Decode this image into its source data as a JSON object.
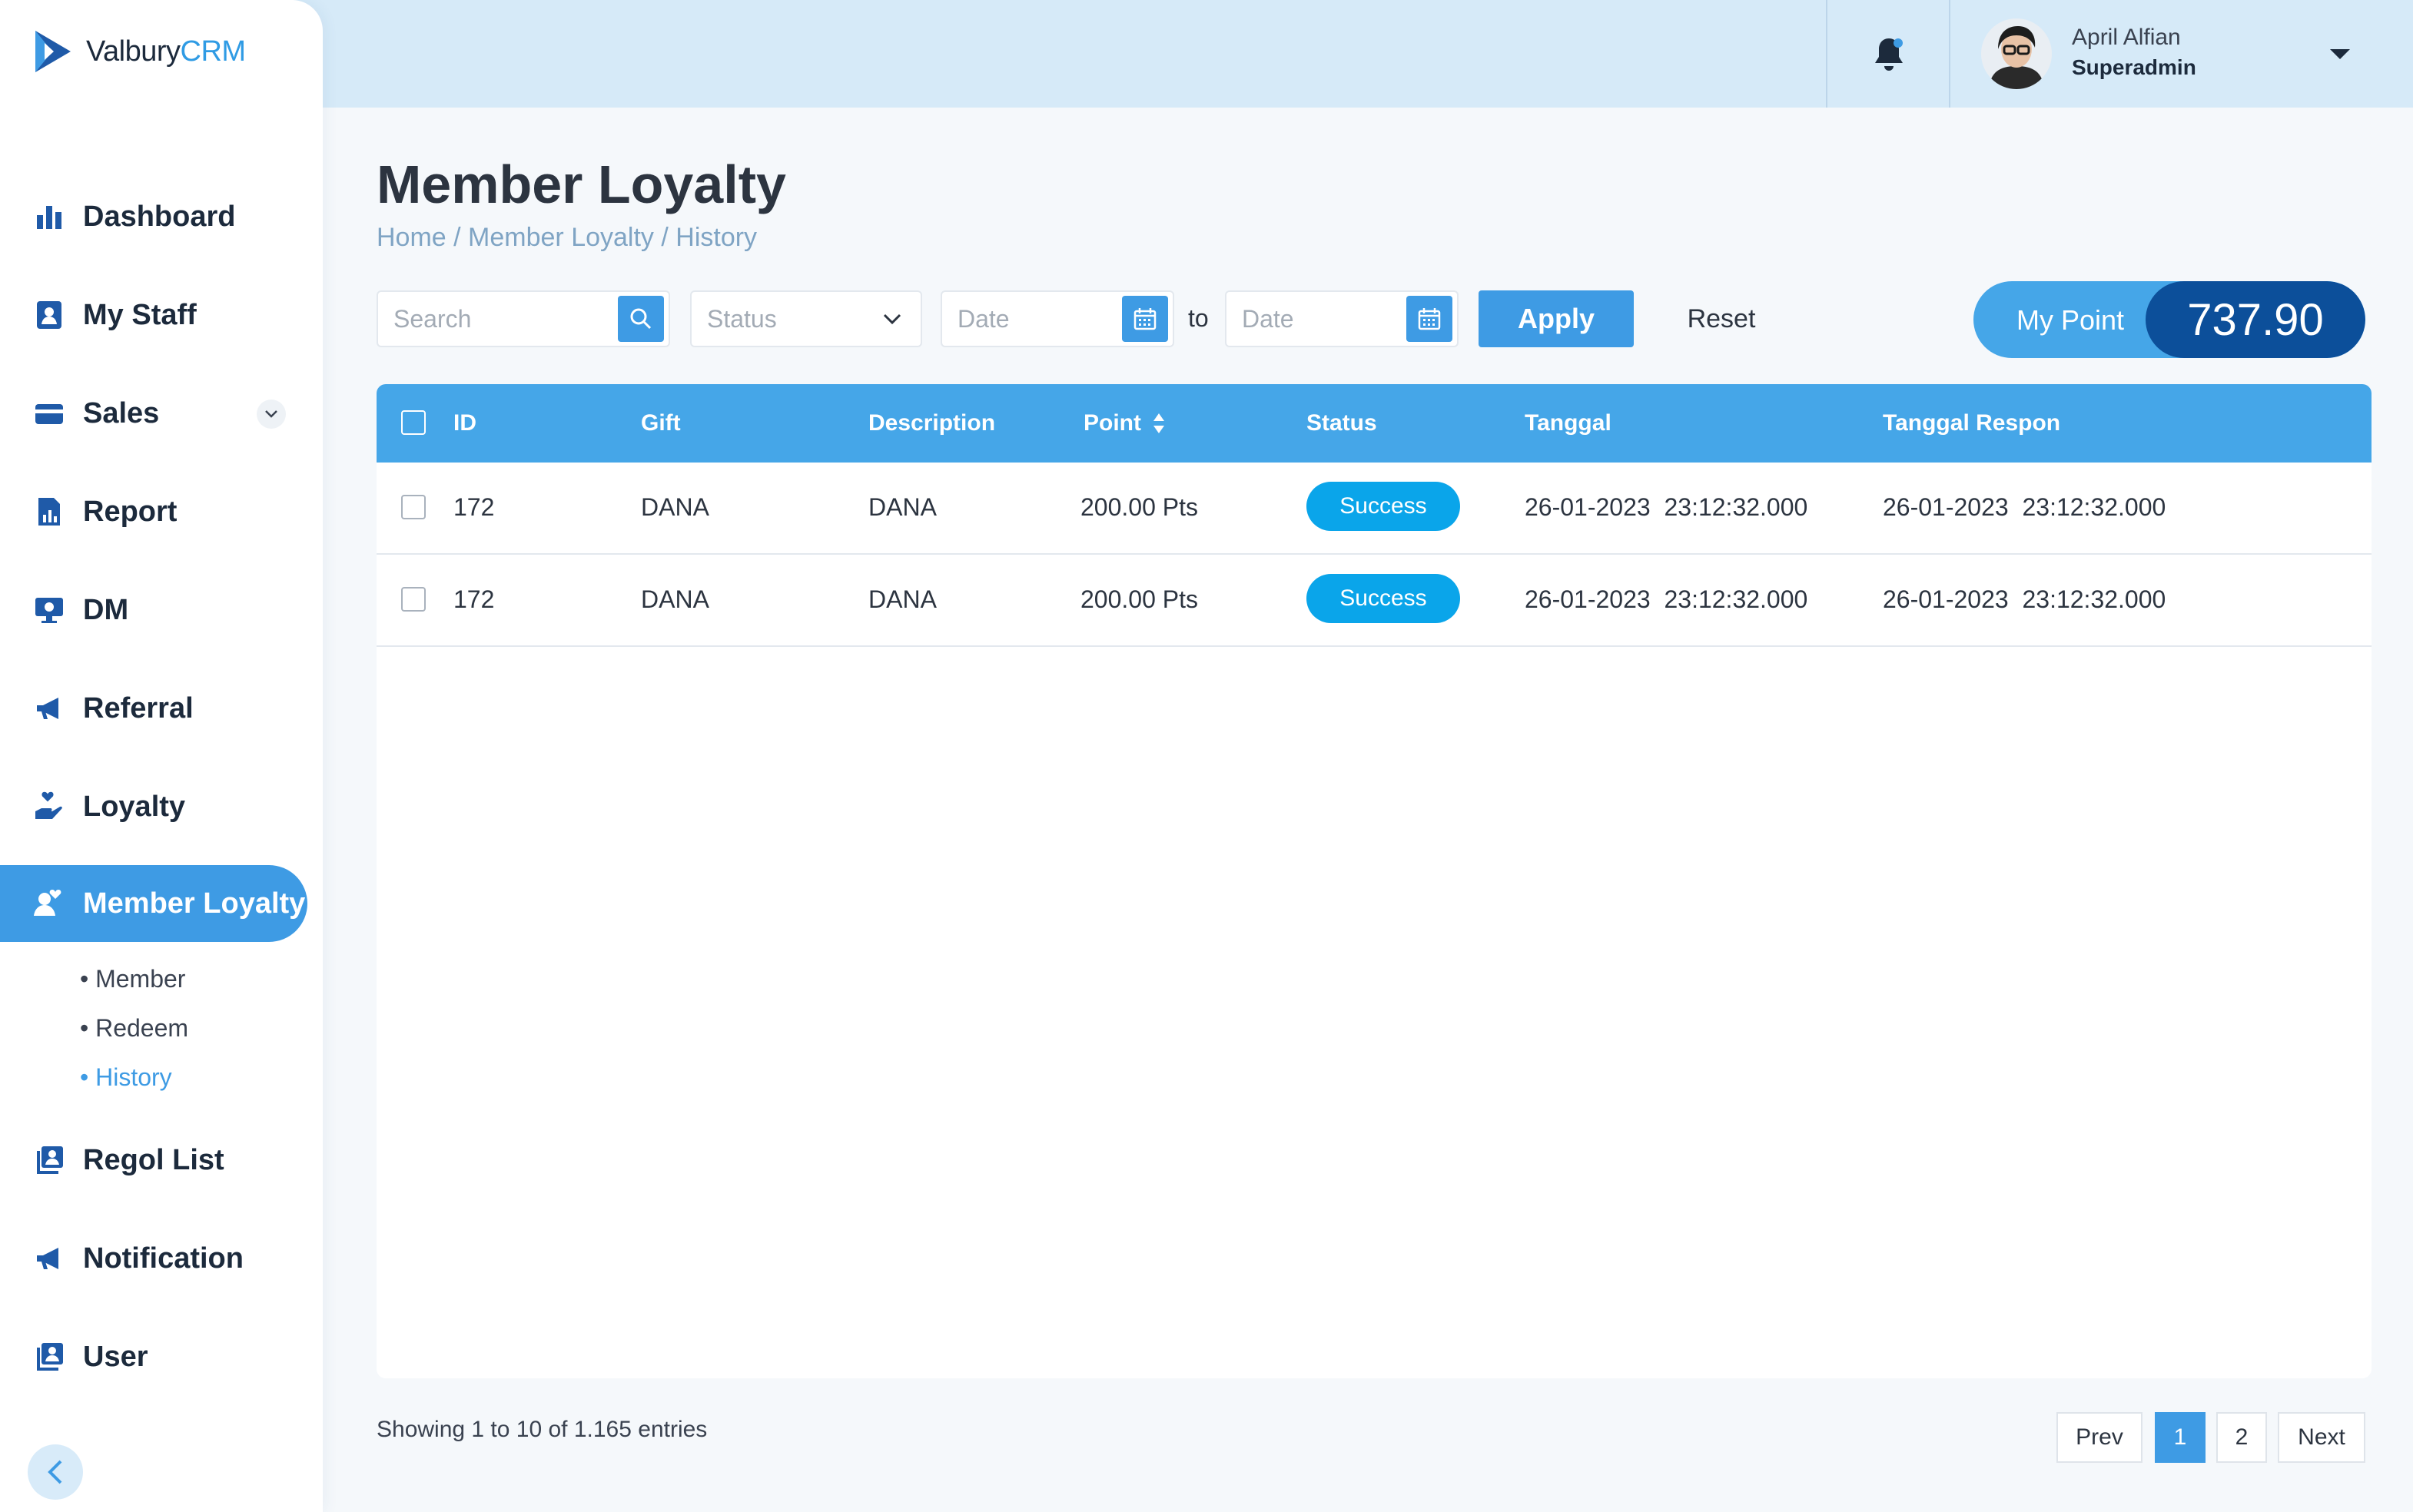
{
  "brand": {
    "name_part1": "Valbury",
    "name_part2": "CRM"
  },
  "sidebar": {
    "items": [
      {
        "label": "Dashboard"
      },
      {
        "label": "My Staff"
      },
      {
        "label": "Sales"
      },
      {
        "label": "Report"
      },
      {
        "label": "DM"
      },
      {
        "label": "Referral"
      },
      {
        "label": "Loyalty"
      },
      {
        "label": "Member Loyalty"
      },
      {
        "label": "Regol List"
      },
      {
        "label": "Notification"
      },
      {
        "label": "User"
      }
    ],
    "subitems": [
      {
        "label": "• Member"
      },
      {
        "label": "• Redeem"
      },
      {
        "label": "• History"
      }
    ]
  },
  "header": {
    "user_name": "April Alfian",
    "user_role": "Superadmin"
  },
  "page": {
    "title": "Member Loyalty",
    "breadcrumb": [
      "Home",
      "Member Loyalty",
      "History"
    ],
    "breadcrumb_sep": " / "
  },
  "filters": {
    "search_placeholder": "Search",
    "status_placeholder": "Status",
    "date_from_placeholder": "Date",
    "to_label": "to",
    "date_to_placeholder": "Date",
    "apply_label": "Apply",
    "reset_label": "Reset"
  },
  "my_point": {
    "label": "My Point",
    "value": "737.90"
  },
  "table": {
    "columns": [
      "ID",
      "Gift",
      "Description",
      "Point",
      "Status",
      "Tanggal",
      "Tanggal Respon"
    ],
    "rows": [
      {
        "id": "172",
        "gift": "DANA",
        "description": "DANA",
        "point": "200.00 Pts",
        "status": "Success",
        "tanggal": "26-01-2023  23:12:32.000",
        "tanggal_respon": "26-01-2023  23:12:32.000"
      },
      {
        "id": "172",
        "gift": "DANA",
        "description": "DANA",
        "point": "200.00 Pts",
        "status": "Success",
        "tanggal": "26-01-2023  23:12:32.000",
        "tanggal_respon": "26-01-2023  23:12:32.000"
      }
    ]
  },
  "footer": {
    "showing": "Showing 1 to 10 of 1.165 entries",
    "prev": "Prev",
    "pages": [
      "1",
      "2"
    ],
    "next": "Next"
  },
  "colors": {
    "accent": "#3e9be4",
    "header_bg": "#d6eaf8",
    "badge_success": "#0aa5ea",
    "point_dark": "#0c4f9a"
  }
}
